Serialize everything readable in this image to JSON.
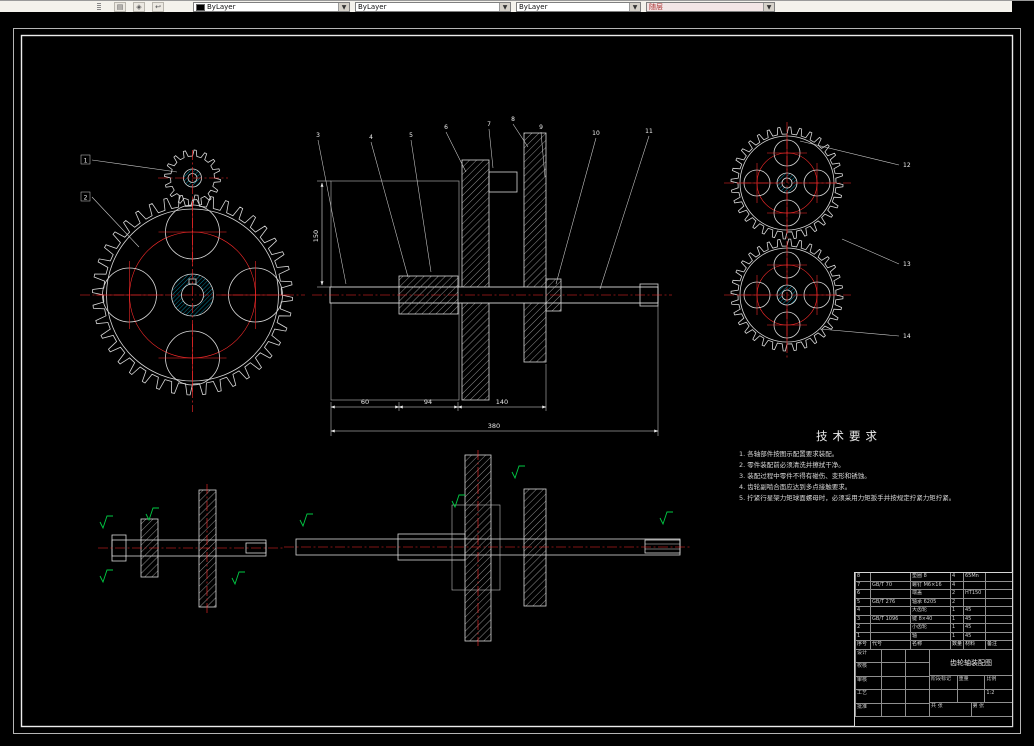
{
  "toolbar": {
    "color_combo": "ByLayer",
    "linetype_combo": "ByLayer",
    "lineweight_combo": "ByLayer",
    "plotstyle_combo": "随层"
  },
  "drawing": {
    "tech_requirements": {
      "title": "技术要求",
      "lines": [
        "1. 各轴部件按图示配置要求装配。",
        "2. 零件装配前必须清洗并擦拭干净。",
        "3. 装配过程中零件不得有碰伤、变形和锈蚀。",
        "4. 齿轮副啮合面应达到多点接触要求。",
        "5. 拧紧行星架力矩球面螺母时，必须采用力矩扳手并按规定拧紧力矩拧紧。"
      ]
    },
    "dimensions": {
      "seg1": "60",
      "seg2": "94",
      "seg3": "140",
      "overall": "380",
      "height": "150"
    },
    "callouts": {
      "left": [
        "1",
        "2"
      ],
      "center": [
        "3",
        "4",
        "5",
        "6",
        "7",
        "8",
        "9",
        "10",
        "11"
      ],
      "right": [
        "12",
        "13",
        "14"
      ]
    }
  },
  "title_block": {
    "header": [
      "序号",
      "代号",
      "名称",
      "数量",
      "材料",
      "备注"
    ],
    "rows": [
      {
        "seq": "8",
        "code": "",
        "name": "垫圈 8",
        "qty": "4",
        "mat": "65Mn",
        "note": ""
      },
      {
        "seq": "7",
        "code": "GB/T 70",
        "name": "螺钉 M6×16",
        "qty": "4",
        "mat": "",
        "note": ""
      },
      {
        "seq": "6",
        "code": "",
        "name": "端盖",
        "qty": "2",
        "mat": "HT150",
        "note": ""
      },
      {
        "seq": "5",
        "code": "GB/T 276",
        "name": "轴承 6205",
        "qty": "2",
        "mat": "",
        "note": ""
      },
      {
        "seq": "4",
        "code": "",
        "name": "大齿轮",
        "qty": "1",
        "mat": "45",
        "note": ""
      },
      {
        "seq": "3",
        "code": "GB/T 1096",
        "name": "键 8×40",
        "qty": "1",
        "mat": "45",
        "note": ""
      },
      {
        "seq": "2",
        "code": "",
        "name": "小齿轮",
        "qty": "1",
        "mat": "45",
        "note": ""
      },
      {
        "seq": "1",
        "code": "",
        "name": "轴",
        "qty": "1",
        "mat": "45",
        "note": ""
      }
    ],
    "fields": {
      "design": "设计",
      "check": "校核",
      "review": "审核",
      "process": "工艺",
      "approve": "批准",
      "stage": "阶段标记",
      "weight": "重量",
      "scale": "比例",
      "scale_value": "1:2",
      "sheets": "共 张",
      "sheet_no": "第 张",
      "title": "齿轮轴装配图"
    }
  }
}
